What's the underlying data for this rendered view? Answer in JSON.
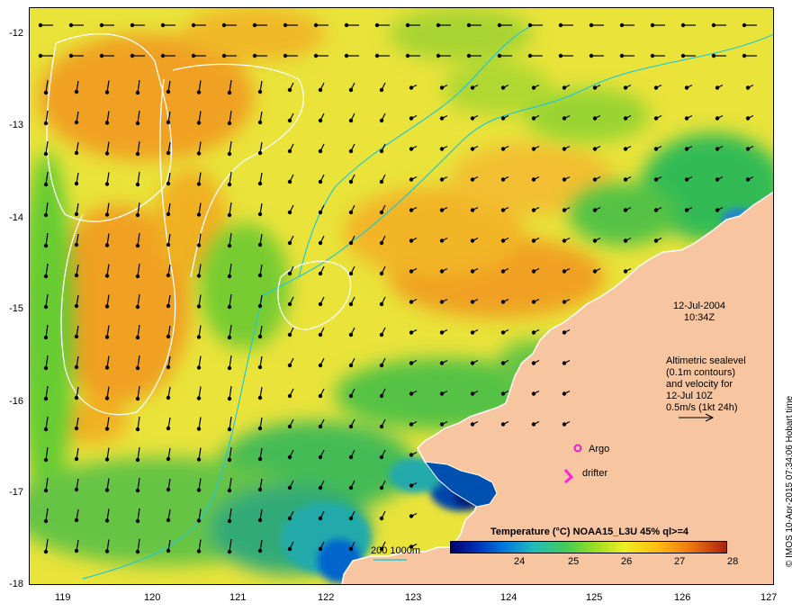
{
  "map": {
    "lon_ticks": [
      "119",
      "120",
      "121",
      "122",
      "123",
      "124",
      "125",
      "126",
      "127"
    ],
    "lat_ticks": [
      "-12",
      "-13",
      "-14",
      "-15",
      "-16",
      "-17",
      "-18"
    ]
  },
  "annotations": {
    "date": "12-Jul-2004",
    "time": "10:34Z",
    "altimetry_line1": "Altimetric sealevel",
    "altimetry_line2": "(0.1m contours)",
    "altimetry_line3": "and velocity for",
    "altimetry_line4": "12-Jul 10Z",
    "altimetry_line5": "0.5m/s (1kt 24h)",
    "argo_label": "Argo",
    "drifter_label": "drifter",
    "isobath_label": "200  1000m"
  },
  "colorbar": {
    "title": "Temperature (°C) NOAA15_L3U 45% ql>=4",
    "ticks": [
      "24",
      "25",
      "26",
      "27",
      "28"
    ]
  },
  "copyright": "© IMOS 10-Apr-2015 07:34:06 Hobart time",
  "colors": {
    "land": "#f7c59f",
    "sst_warm": "#f0a020",
    "sst_mid": "#e9e33a",
    "sst_cool": "#33bb55",
    "sst_cold": "#0033aa",
    "isobath": "#22c8d8",
    "contour": "#ffffff",
    "argo": "#dd22cc",
    "drifter": "#ff22dd"
  }
}
